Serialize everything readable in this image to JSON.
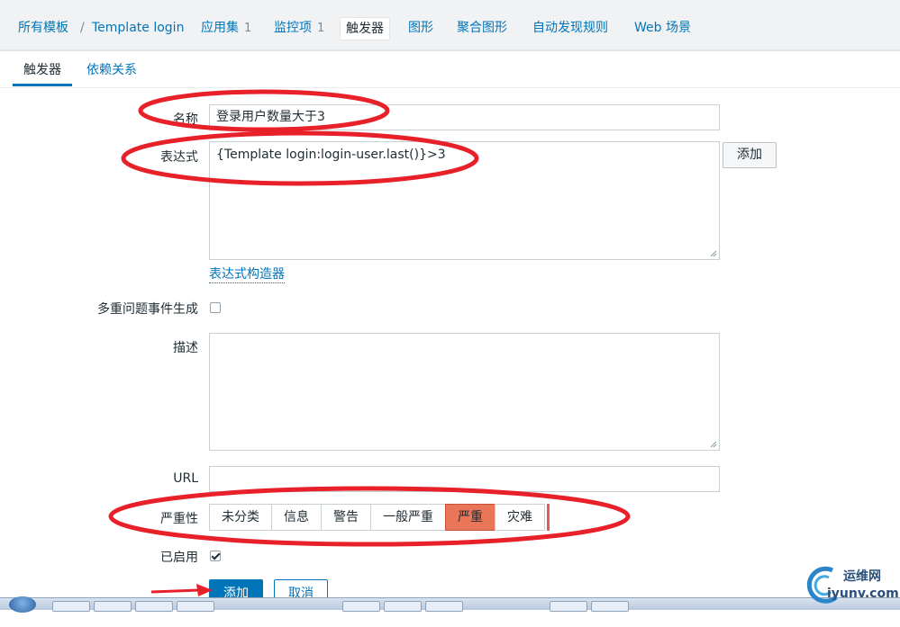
{
  "breadcrumb": {
    "all_templates": "所有模板",
    "separator": "/",
    "template_name": "Template login"
  },
  "nav": {
    "applications": {
      "label": "应用集",
      "count": "1"
    },
    "items": {
      "label": "监控项",
      "count": "1"
    },
    "triggers": "触发器",
    "graphs": "图形",
    "screens": "聚合图形",
    "discovery": "自动发现规则",
    "web": "Web 场景"
  },
  "tabs": {
    "trigger": "触发器",
    "dependencies": "依赖关系"
  },
  "form": {
    "name_label": "名称",
    "name_value": "登录用户数量大于3",
    "expression_label": "表达式",
    "expression_value": "{Template login:login-user.last()}>3",
    "add_expression_button": "添加",
    "expression_constructor": "表达式构造器",
    "multiple_events_label": "多重问题事件生成",
    "description_label": "描述",
    "url_label": "URL",
    "url_value": "",
    "severity_label": "严重性",
    "severity_options": [
      "未分类",
      "信息",
      "警告",
      "一般严重",
      "严重",
      "灾难"
    ],
    "severity_selected": "严重",
    "enabled_label": "已启用",
    "add_button": "添加",
    "cancel_button": "取消"
  },
  "watermark": {
    "name": "运维网",
    "url": "iyunv.com"
  },
  "colors": {
    "link": "#0275b8",
    "severity_high": "#e97659",
    "annotation": "#e8202a"
  }
}
